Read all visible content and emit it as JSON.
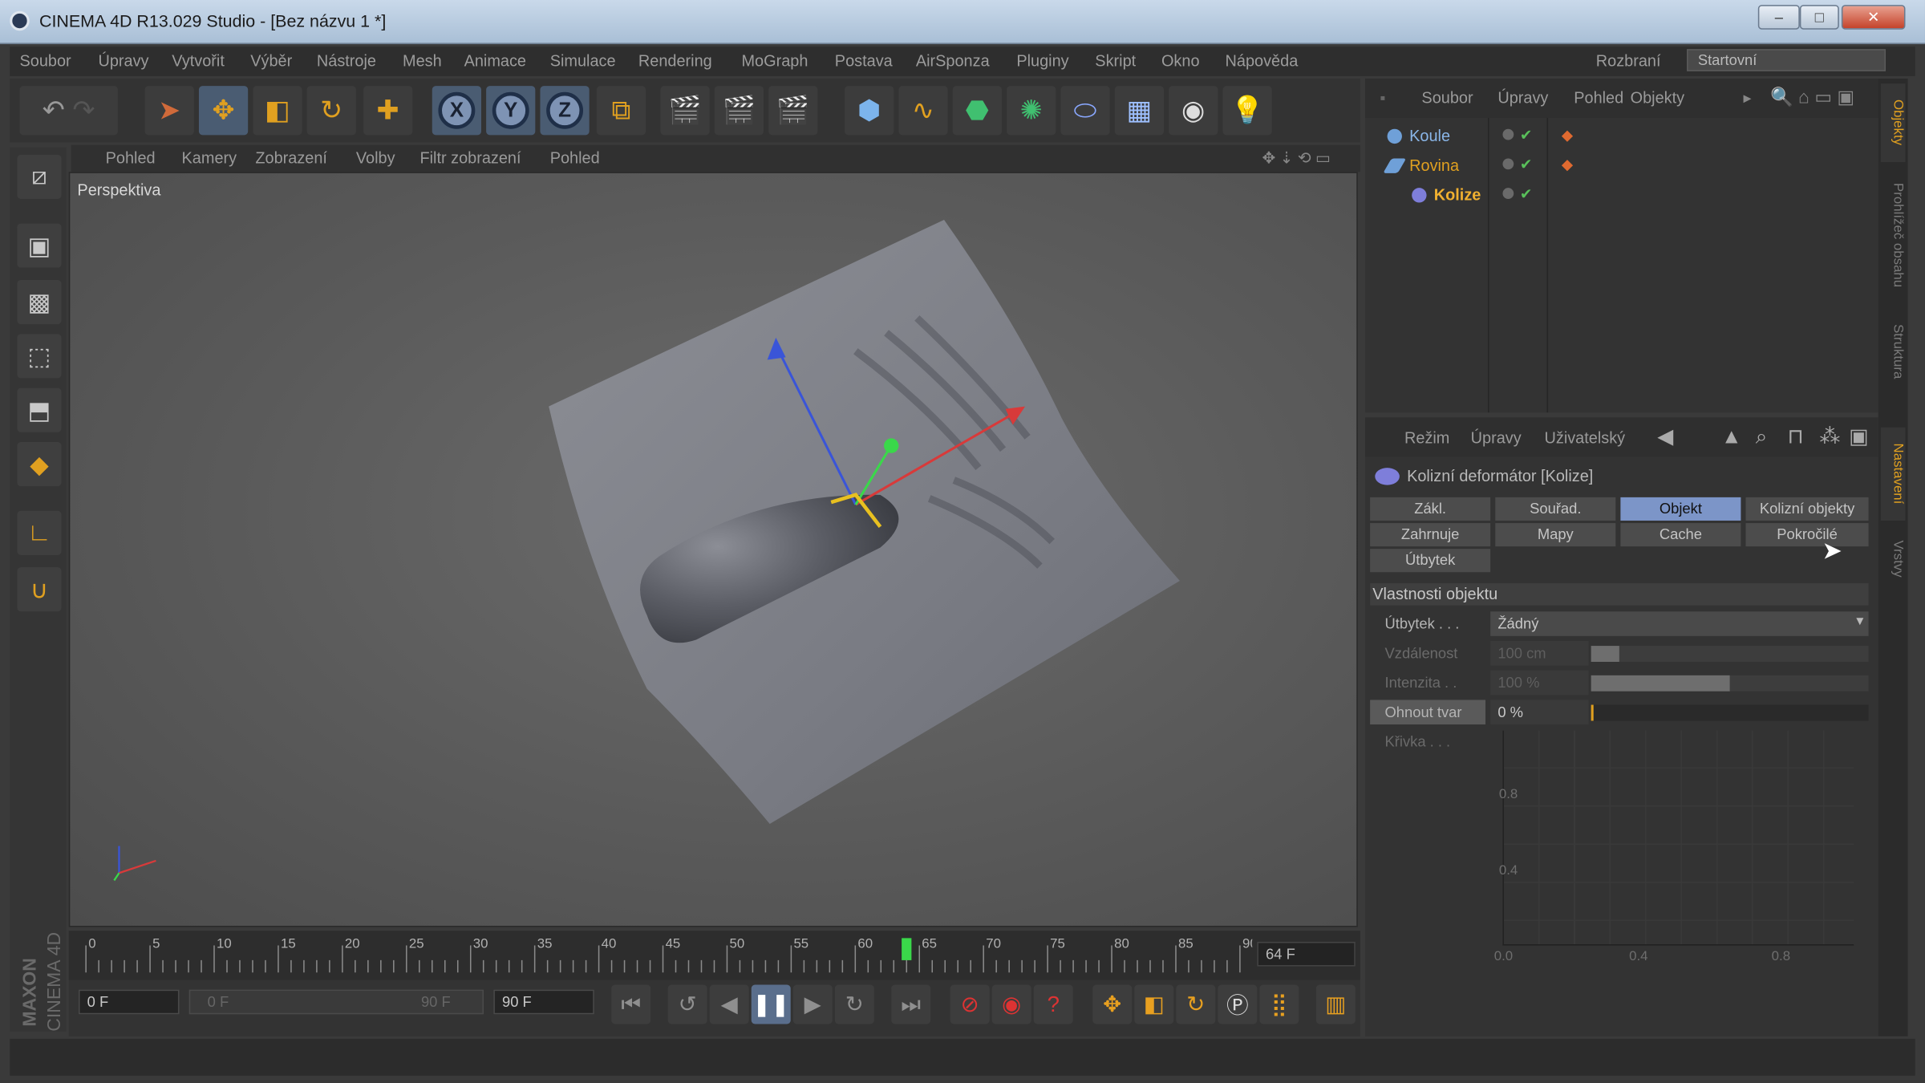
{
  "window": {
    "title": "CINEMA 4D R13.029 Studio - [Bez názvu 1 *]",
    "min": "–",
    "max": "□",
    "close": "✕"
  },
  "menubar": {
    "items": [
      "Soubor",
      "Úpravy",
      "Vytvořit",
      "Výběr",
      "Nástroje",
      "Mesh",
      "Animace",
      "Simulace",
      "Rendering",
      "MoGraph",
      "Postava",
      "AirSponza",
      "Pluginy",
      "Skript",
      "Okno",
      "Nápověda"
    ],
    "layout_label": "Rozbraní",
    "layout_value": "Startovní"
  },
  "toolbar": {
    "undo": "↶",
    "redo": "↷",
    "x": "X",
    "y": "Y",
    "z": "Z"
  },
  "viewport": {
    "menu": [
      "Pohled",
      "Kamery",
      "Zobrazení",
      "Volby",
      "Filtr zobrazení",
      "Pohled"
    ],
    "label": "Perspektiva"
  },
  "timeline": {
    "ticks": [
      "0",
      "5",
      "10",
      "15",
      "20",
      "25",
      "30",
      "35",
      "40",
      "45",
      "50",
      "55",
      "60",
      "65",
      "70",
      "75",
      "80",
      "85",
      "90"
    ],
    "current_frame": 64,
    "max_frame": 90,
    "end_field": "64 F",
    "start_field": "0 F",
    "range_start": "0 F",
    "range_end": "90 F",
    "end_field2": "90 F"
  },
  "object_manager": {
    "menu": [
      "Soubor",
      "Úpravy",
      "Pohled",
      "Objekty"
    ],
    "objects": [
      {
        "name": "Koule",
        "color": "#8ab6e8"
      },
      {
        "name": "Rovina",
        "color": "#e0a020"
      },
      {
        "name": "Kolize",
        "color": "#f0b030"
      }
    ]
  },
  "right_tabs": [
    "Objekty",
    "Prohlížeč obsahu",
    "Struktura",
    "Nastavení",
    "Vrstvy"
  ],
  "attribute_manager": {
    "menu": [
      "Režim",
      "Úpravy",
      "Uživatelský"
    ],
    "title": "Kolizní deformátor [Kolize]",
    "tabs": [
      "Zákl.",
      "Souřad.",
      "Objekt",
      "Kolizní objekty",
      "Zahrnuje",
      "Mapy",
      "Cache",
      "Pokročilé",
      "Útbytek"
    ],
    "active_tab": "Objekt",
    "section": "Vlastnosti objektu",
    "params": [
      {
        "label": "Útbytek . . .",
        "value": "Žádný"
      },
      {
        "label": "Vzdálenost",
        "value": "100 cm",
        "fill": 0.1
      },
      {
        "label": "Intenzita . .",
        "value": "100 %",
        "fill": 0.5
      },
      {
        "label": "Ohnout tvar",
        "value": "0 %",
        "fill": 0.0
      },
      {
        "label": "Křivka . . ."
      }
    ],
    "graph_y": [
      "0.8",
      "0.4"
    ],
    "graph_x": [
      "0.0",
      "0.4",
      "0.8"
    ]
  }
}
